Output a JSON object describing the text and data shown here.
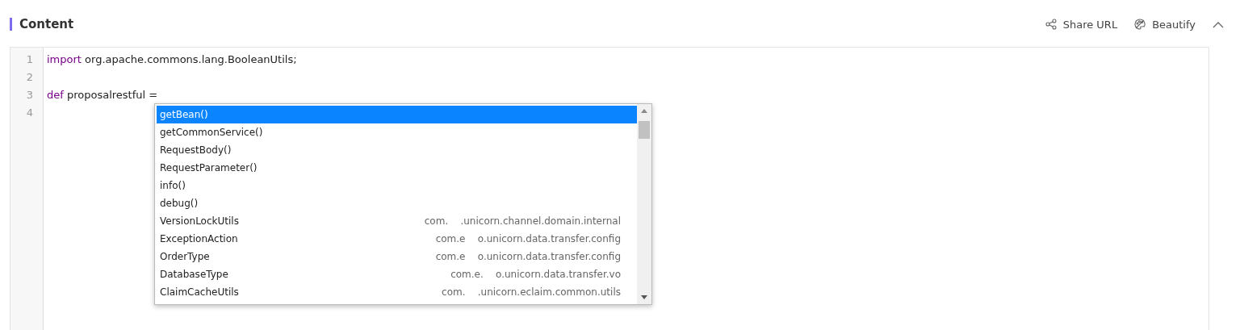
{
  "header": {
    "title": "Content",
    "actions": [
      {
        "kind": "share",
        "label": "Share URL"
      },
      {
        "kind": "beautify",
        "label": "Beautify"
      },
      {
        "kind": "collapse"
      }
    ]
  },
  "editor": {
    "lines": [
      {
        "number": "1",
        "tokens": [
          {
            "kind": "keyword",
            "text": "import"
          },
          {
            "kind": "plain",
            "text": " org.apache.commons.lang.BooleanUtils;"
          }
        ]
      },
      {
        "number": "2"
      },
      {
        "number": "3",
        "tokens": [
          {
            "kind": "keyword",
            "text": "def"
          },
          {
            "kind": "plain",
            "text": " proposalrestful ="
          }
        ]
      },
      {
        "number": "4"
      }
    ],
    "autocomplete": [
      {
        "label": "getBean()",
        "selected": true
      },
      {
        "label": "getCommonService()",
        "selected": false
      },
      {
        "label": "RequestBody()",
        "selected": false
      },
      {
        "label": "RequestParameter()",
        "selected": false
      },
      {
        "label": "info()",
        "selected": false
      },
      {
        "label": "debug()",
        "selected": false
      },
      {
        "label": "VersionLockUtils",
        "selected": false,
        "detail_start": "com.",
        "detail_end": ".unicorn.channel.domain.internal"
      },
      {
        "label": "ExceptionAction",
        "selected": false,
        "detail_start": "com.e",
        "detail_end": "o.unicorn.data.transfer.config"
      },
      {
        "label": "OrderType",
        "selected": false,
        "detail_start": "com.e",
        "detail_end": "o.unicorn.data.transfer.config"
      },
      {
        "label": "DatabaseType",
        "selected": false,
        "detail_start": "com.e.",
        "detail_end": "o.unicorn.data.transfer.vo"
      },
      {
        "label": "ClaimCacheUtils",
        "selected": false,
        "detail_start": "com.",
        "detail_end": ".unicorn.eclaim.common.utils"
      }
    ]
  }
}
